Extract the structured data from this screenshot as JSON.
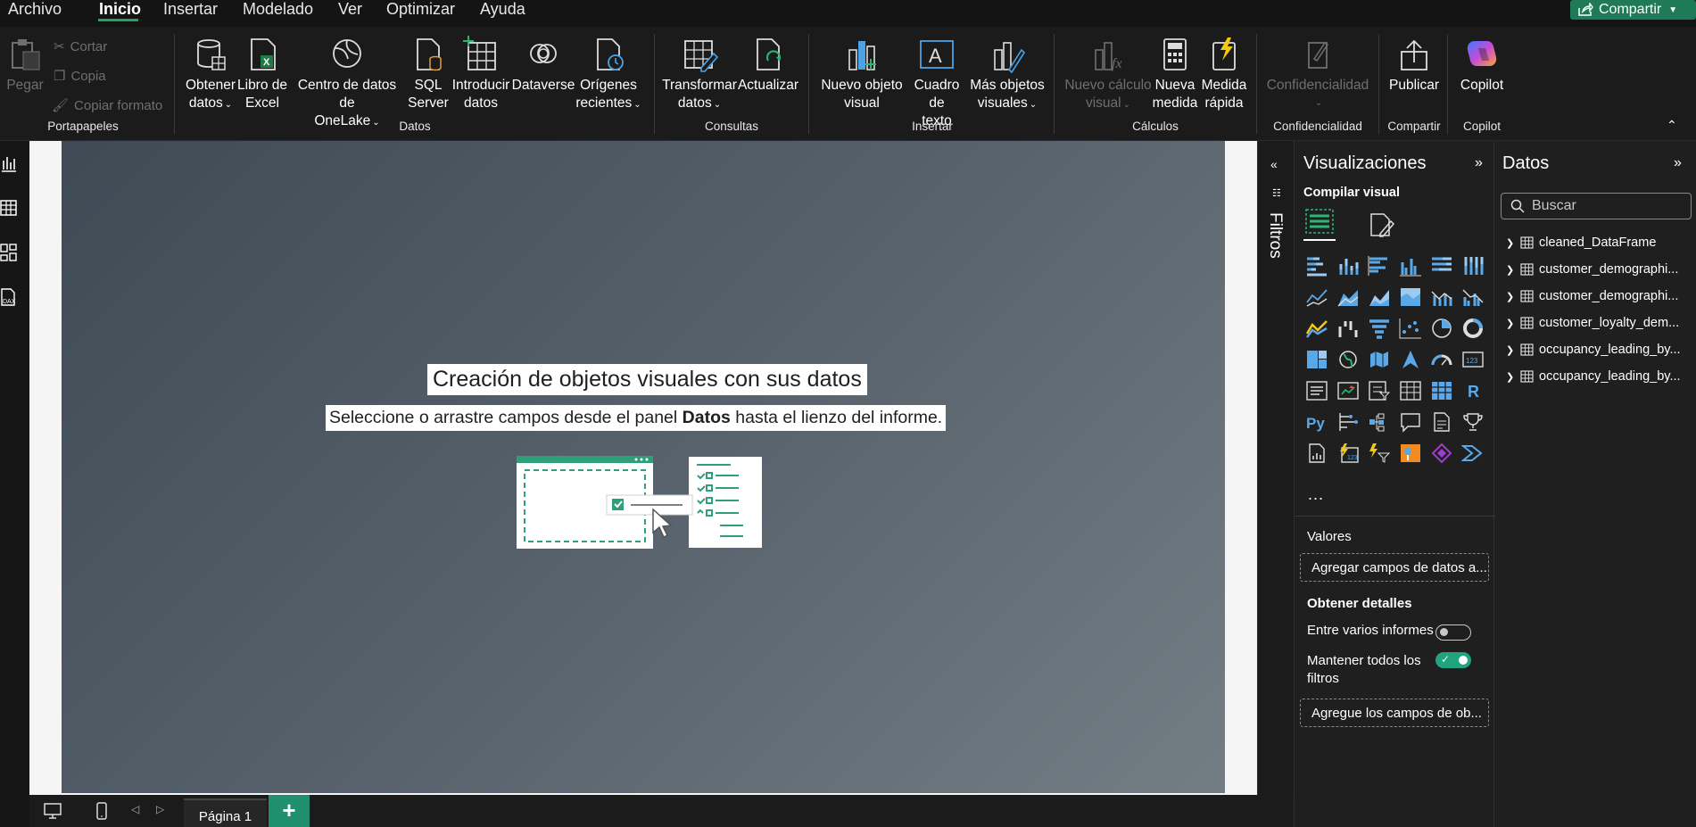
{
  "menu": {
    "items": [
      "Archivo",
      "Inicio",
      "Insertar",
      "Modelado",
      "Ver",
      "Optimizar",
      "Ayuda"
    ],
    "active": "Inicio",
    "share_label": "Compartir"
  },
  "ribbon": {
    "clipboard": {
      "paste": "Pegar",
      "cut": "Cortar",
      "copy": "Copia",
      "format_painter": "Copiar formato",
      "group": "Portapapeles"
    },
    "data": {
      "get_data": [
        "Obtener",
        "datos"
      ],
      "excel": [
        "Libro de",
        "Excel"
      ],
      "onelake": [
        "Centro de datos de",
        "OneLake"
      ],
      "sql": [
        "SQL",
        "Server"
      ],
      "enter_data": [
        "Introducir",
        "datos"
      ],
      "dataverse": "Dataverse",
      "recent": [
        "Orígenes",
        "recientes"
      ],
      "group": "Datos"
    },
    "queries": {
      "transform": [
        "Transformar",
        "datos"
      ],
      "refresh": "Actualizar",
      "group": "Consultas"
    },
    "insert": {
      "new_visual": [
        "Nuevo objeto",
        "visual"
      ],
      "textbox": [
        "Cuadro de",
        "texto"
      ],
      "more_visuals": [
        "Más objetos",
        "visuales"
      ],
      "group": "Insertar"
    },
    "calculations": {
      "new_calc": [
        "Nuevo cálculo",
        "visual"
      ],
      "new_measure": [
        "Nueva",
        "medida"
      ],
      "quick_measure": [
        "Medida",
        "rápida"
      ],
      "group": "Cálculos"
    },
    "sensitivity": {
      "label": "Confidencialidad",
      "group": "Confidencialidad"
    },
    "share": {
      "publish": "Publicar",
      "group": "Compartir"
    },
    "copilot": {
      "label": "Copilot",
      "group": "Copilot"
    }
  },
  "canvas": {
    "title": "Creación de objetos visuales con sus datos",
    "subtitle_before": "Seleccione o arrastre campos desde el panel ",
    "subtitle_bold": "Datos",
    "subtitle_after": " hasta el lienzo del informe."
  },
  "filters": {
    "label": "Filtros"
  },
  "visualizations": {
    "title": "Visualizaciones",
    "build_visual": "Compilar visual",
    "more": "...",
    "values_label": "Valores",
    "values_placeholder": "Agregar campos de datos a...",
    "drillthrough_label": "Obtener detalles",
    "cross_report": "Entre varios informes",
    "cross_report_on": false,
    "keep_filters": [
      "Mantener todos los",
      "filtros"
    ],
    "keep_filters_on": true,
    "drillthrough_placeholder": "Agregue los campos de ob..."
  },
  "data_pane": {
    "title": "Datos",
    "search_placeholder": "Buscar",
    "tables": [
      "cleaned_DataFrame",
      "customer_demographi...",
      "customer_demographi...",
      "customer_loyalty_dem...",
      "occupancy_leading_by...",
      "occupancy_leading_by..."
    ]
  },
  "bottom": {
    "page_tab": "Página 1",
    "add_page": "+"
  },
  "colors": {
    "accent": "#21a366",
    "share": "#1f7a58",
    "toggle_on": "#21a37e",
    "page_add": "#1f8f6d",
    "visual_blue": "#5aa8e8"
  }
}
